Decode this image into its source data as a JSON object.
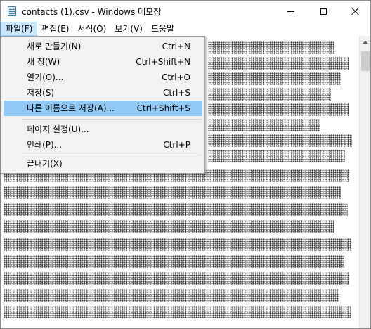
{
  "window": {
    "title": "contacts (1).csv - Windows 메모장"
  },
  "icons": {
    "app": "notepad-icon",
    "minimize": "minimize-icon",
    "maximize": "maximize-icon",
    "close": "close-icon",
    "scroll_up": "chevron-up-icon"
  },
  "menubar": [
    {
      "label": "파일(F)",
      "active": true
    },
    {
      "label": "편집(E)"
    },
    {
      "label": "서식(O)"
    },
    {
      "label": "보기(V)"
    },
    {
      "label": "도움말"
    }
  ],
  "file_menu": {
    "items": [
      {
        "label": "새로 만들기(N)",
        "shortcut": "Ctrl+N"
      },
      {
        "label": "새 창(W)",
        "shortcut": "Ctrl+Shift+N"
      },
      {
        "label": "열기(O)...",
        "shortcut": "Ctrl+O"
      },
      {
        "label": "저장(S)",
        "shortcut": "Ctrl+S"
      },
      {
        "label": "다른 이름으로 저장(A)...",
        "shortcut": "Ctrl+Shift+S",
        "highlighted": true
      },
      {
        "label": "페이지 설정(U)...",
        "shortcut": ""
      },
      {
        "label": "인쇄(P)...",
        "shortcut": "Ctrl+P"
      },
      {
        "label": "끝내기(X)",
        "shortcut": ""
      }
    ]
  },
  "colors": {
    "menu_highlight": "#91c9f7",
    "menubar_active": "#cce8ff",
    "dropdown_bg": "#f2f2f2"
  }
}
